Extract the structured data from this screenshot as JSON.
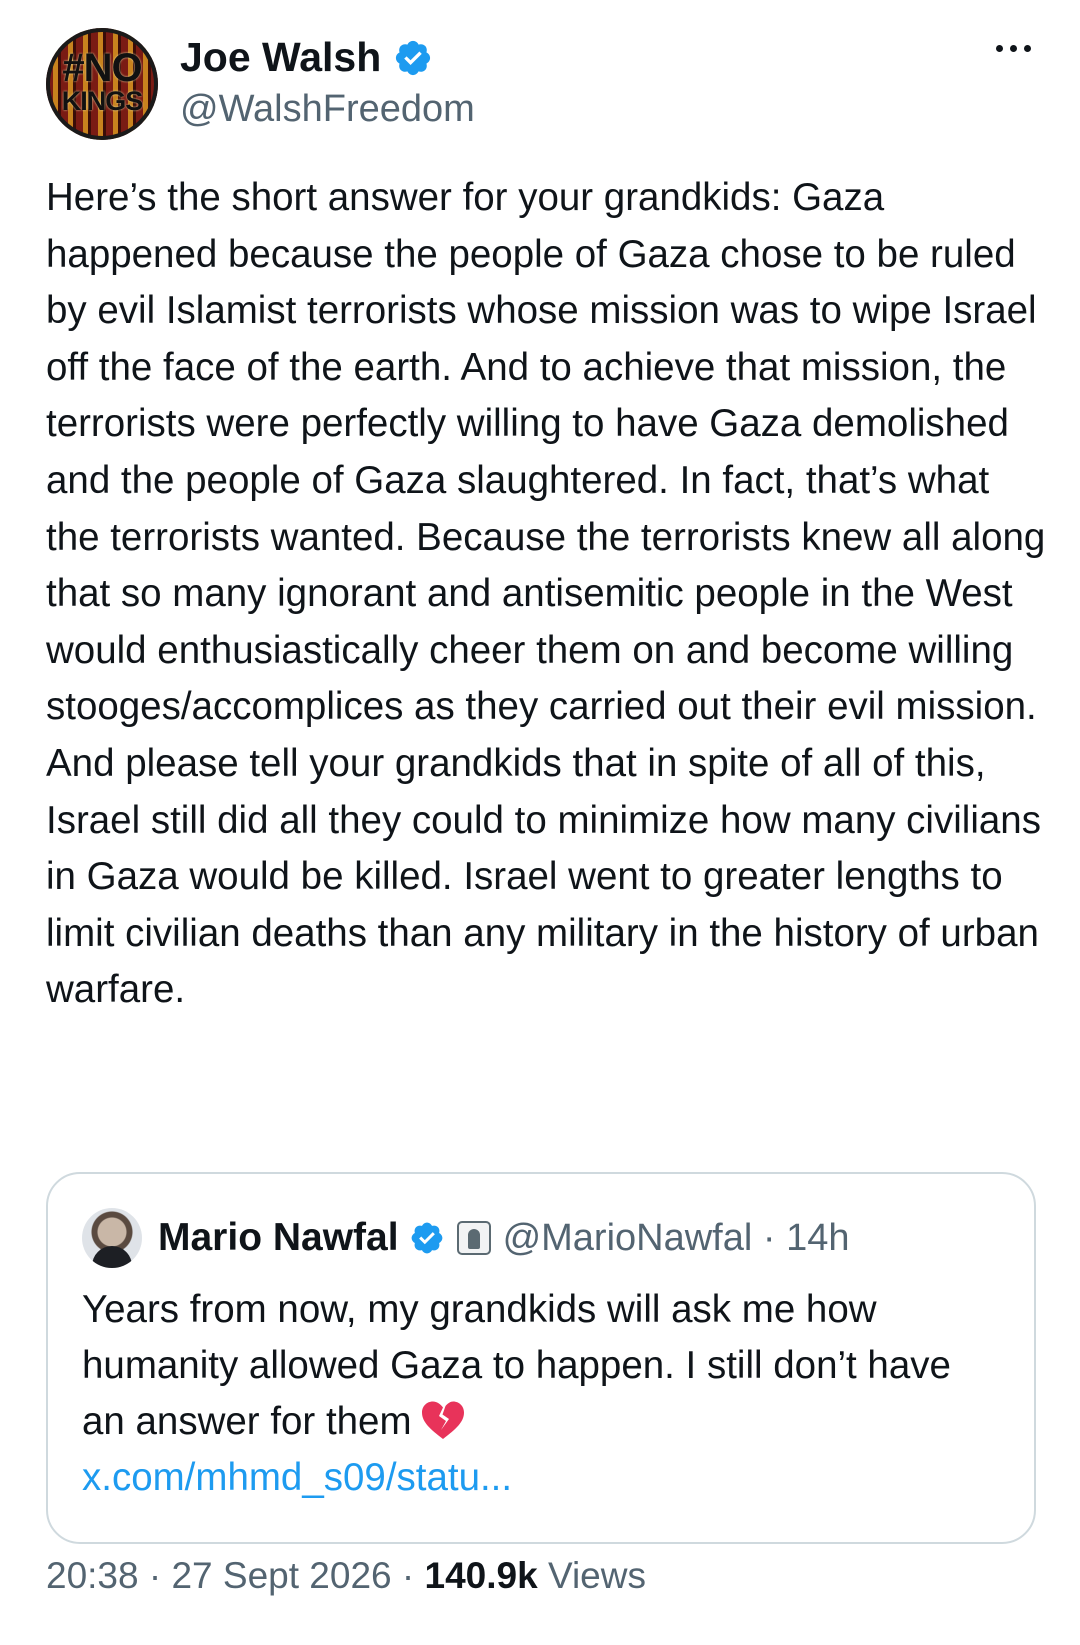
{
  "author": {
    "avatar_text_line1": "#NO",
    "avatar_text_line2": "KINGS",
    "display_name": "Joe Walsh",
    "handle": "@WalshFreedom",
    "verified": true
  },
  "tweet": {
    "text": "Here’s the short answer for your grandkids: Gaza happened because the people of Gaza chose to be ruled by evil Islamist terrorists whose mission was to wipe Israel off the face of the earth. And to achieve that mission, the terrorists were perfectly willing to have Gaza demolished and the people of Gaza slaughtered. In fact, that’s what the terrorists wanted. Because the terrorists knew all along that so many ignorant and antisemitic people in the West would enthusiastically cheer them on and become willing stooges/accomplices as they carried out their evil mission. And please tell your grandkids that in spite of all of this, Israel still did all they could to minimize how many civilians in Gaza would be killed. Israel went to greater lengths to limit civilian deaths than any military in the history of urban warfare."
  },
  "quoted": {
    "display_name": "Mario Nawfal",
    "handle_time": "@MarioNawfal · 14h",
    "text": "Years from now, my grandkids will ask me how humanity allowed Gaza to happen. I still don’t have an answer for them",
    "link": "x.com/mhmd_s09/statu..."
  },
  "footer": {
    "time_date": "20:38 · 27 Sept 2026 · ",
    "views_count": "140.9k",
    "views_label": " Views"
  },
  "icons": {
    "verified": "verified-badge-icon",
    "more": "more-options-icon",
    "affiliate": "affiliate-badge-icon",
    "emoji": "broken-heart-icon"
  },
  "colors": {
    "verified": "#1d9bf0",
    "link": "#1d9bf0",
    "secondary_text": "#536471",
    "border": "#cfd9de"
  }
}
